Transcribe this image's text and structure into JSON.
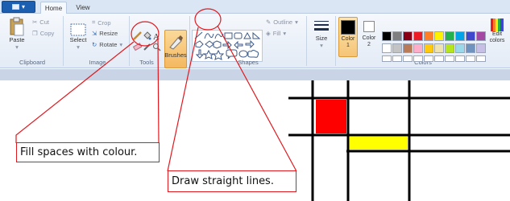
{
  "tabs": {
    "file_label": "",
    "home": "Home",
    "view": "View"
  },
  "clipboard": {
    "paste": "Paste",
    "cut": "Cut",
    "copy": "Copy",
    "group": "Clipboard"
  },
  "image": {
    "select": "Select",
    "crop": "Crop",
    "resize": "Resize",
    "rotate": "Rotate",
    "group": "Image"
  },
  "tools": {
    "group": "Tools"
  },
  "brushes": {
    "label": "Brushes"
  },
  "shapes": {
    "outline": "Outline",
    "fill": "Fill",
    "group": "Shapes"
  },
  "size": {
    "label": "Size"
  },
  "colors": {
    "color1": "Color 1",
    "color2": "Color 2",
    "edit": "Edit colors",
    "group": "Colors",
    "palette_row1": [
      "#000000",
      "#7f7f7f",
      "#880015",
      "#ed1c24",
      "#ff7f27",
      "#fff200",
      "#22b14c",
      "#00a2e8",
      "#3f48cc",
      "#a349a4"
    ],
    "palette_row2": [
      "#ffffff",
      "#c3c3c3",
      "#b97a57",
      "#ffaec9",
      "#ffc90e",
      "#efe4b0",
      "#b5e61d",
      "#99d9ea",
      "#7092be",
      "#c8bfe7"
    ]
  },
  "annotations": {
    "fill": "Fill spaces with colour.",
    "lines": "Draw straight lines."
  },
  "artwork": {
    "red": "#ff0000",
    "yellow": "#ffff00",
    "line": "#000000"
  },
  "accent": {
    "callout_border": "#e0191f"
  }
}
